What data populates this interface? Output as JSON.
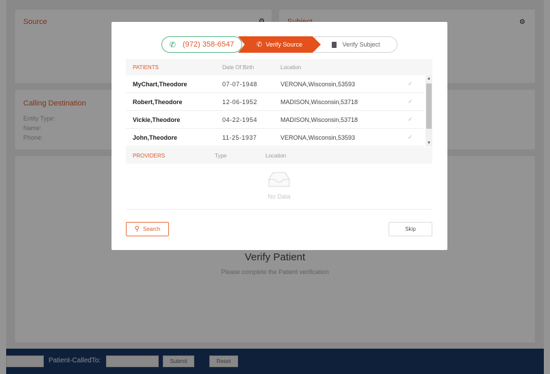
{
  "background": {
    "source_card": {
      "title": "Source"
    },
    "subject_card": {
      "title": "Subject"
    },
    "calling_destination": {
      "title": "Calling Destination",
      "entity_type_label": "Entity Type:",
      "name_label": "Name:",
      "phone_label": "Phone:"
    },
    "verify_title": "Verify Patient",
    "verify_subtitle": "Please complete the Patient verification",
    "bottom_bar": {
      "called_to_label": "Patient-CalledTo:",
      "submit_label": "Submit",
      "reset_label": "Reset"
    }
  },
  "modal": {
    "steps": {
      "phone": "(972) 358-6547",
      "verify_source": "Verify Source",
      "verify_subject": "Verify Subject"
    },
    "patients_table": {
      "headers": {
        "patients": "PATIENTS",
        "dob": "Date Of Birth",
        "location": "Location"
      },
      "rows": [
        {
          "name": "MyChart,Theodore",
          "dob": "07-07-1948",
          "location": "VERONA,Wisconsin,53593"
        },
        {
          "name": "Robert,Theodore",
          "dob": "12-06-1952",
          "location": "MADISON,Wisconsin,53718"
        },
        {
          "name": "Vickie,Theodore",
          "dob": "04-22-1954",
          "location": "MADISON,Wisconsin,53718"
        },
        {
          "name": "John,Theodore",
          "dob": "11-25-1937",
          "location": "VERONA,Wisconsin,53593"
        }
      ]
    },
    "providers_table": {
      "headers": {
        "providers": "PROVIDERS",
        "type": "Type",
        "location": "Location"
      },
      "empty_text": "No Data"
    },
    "search_label": "Search",
    "skip_label": "Skip"
  },
  "colors": {
    "accent": "#e05a2b",
    "active_step": "#e5511b",
    "phone_border": "#5bb88a",
    "bottom_bar": "#1b3767"
  }
}
